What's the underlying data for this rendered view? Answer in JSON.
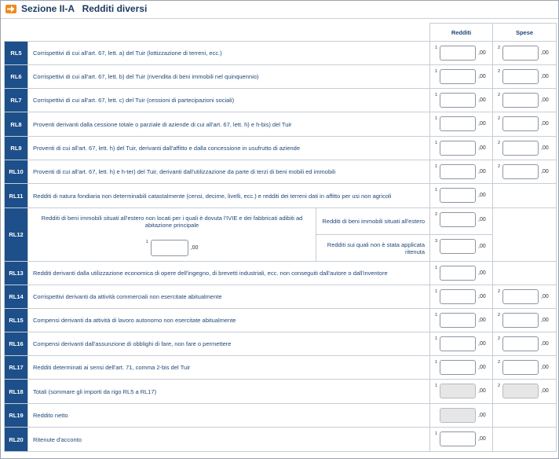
{
  "header": {
    "section": "Sezione II-A",
    "title": "Redditi diversi"
  },
  "columns": {
    "redditi": "Redditi",
    "spese": "Spese"
  },
  "zero_suffix": ",00",
  "rows": [
    {
      "code": "RL5",
      "desc": "Corrispettivi di cui all'art. 67, lett. a) del Tuir (lottizzazione di terreni, ecc.)",
      "n1": "1",
      "n2": "2"
    },
    {
      "code": "RL6",
      "desc": "Corrispettivi di cui all'art. 67, lett. b) del Tuir (rivendita di beni immobili nel quinquennio)",
      "n1": "1",
      "n2": "2"
    },
    {
      "code": "RL7",
      "desc": "Corrispettivi di cui all'art. 67, lett. c) del Tuir (cessioni di partecipazioni sociali)",
      "n1": "1",
      "n2": "2"
    },
    {
      "code": "RL8",
      "desc": "Proventi derivanti dalla cessione totale o parziale di aziende di cui all'art. 67, lett. h) e h-bis) del Tuir",
      "n1": "1",
      "n2": "2"
    },
    {
      "code": "RL9",
      "desc": "Proventi di cui all'art. 67, lett. h) del Tuir, derivanti dall'affitto e dalla concessione in usufrutto di aziende",
      "n1": "1",
      "n2": "2"
    },
    {
      "code": "RL10",
      "desc": "Proventi di cui all'art. 67, lett. h) e h-ter) del Tuir, derivanti dall'utilizzazione da parte di terzi di beni mobili ed immobili",
      "n1": "1",
      "n2": "2"
    },
    {
      "code": "RL11",
      "desc": "Redditi di natura fondiaria non determinabili catastalmente (censi, decime, livelli, ecc.) e redditi dei terreni dati in affitto per usi non agricoli",
      "n1": "1"
    },
    {
      "code": "RL13",
      "desc": "Redditi derivanti dalla utilizzazione economica di opere dell'ingegno, di brevetti industriali, ecc. non conseguiti dall'autore o dall'inventore",
      "n1": "1"
    },
    {
      "code": "RL14",
      "desc": "Corrispettivi derivanti da attività commerciali non esercitate abitualmente",
      "n1": "1",
      "n2": "2"
    },
    {
      "code": "RL15",
      "desc": "Compensi derivanti da attività di lavoro autonomo non esercitate abitualmente",
      "n1": "1",
      "n2": "2"
    },
    {
      "code": "RL16",
      "desc": "Compensi derivanti dall'assunzione di obblighi di fare, non fare o permettere",
      "n1": "1",
      "n2": "2"
    },
    {
      "code": "RL17",
      "desc": "Redditi determinati ai sensi dell'art. 71, comma 2-bis del Tuir",
      "n1": "1",
      "n2": "2"
    },
    {
      "code": "RL18",
      "desc": "Totali (sommare gli importi da rigo RL5 a RL17)",
      "n1": "1",
      "n2": "2"
    },
    {
      "code": "RL19",
      "desc": "Reddito netto",
      "n1": ""
    },
    {
      "code": "RL20",
      "desc": "Ritenute d'acconto",
      "n1": "1"
    }
  ],
  "rl12": {
    "code": "RL12",
    "left_desc": "Redditi di beni immobili situati all'estero non locati per i quali è dovuta l'IVIE e dei fabbricati adibiti ad abitazione principale",
    "left_num": "1",
    "right_desc_a": "Redditi di beni immobili situati all'estero",
    "right_num_a": "2",
    "right_desc_b": "Redditi sui quali non è stata applicata ritenuta",
    "right_num_b": "3"
  }
}
